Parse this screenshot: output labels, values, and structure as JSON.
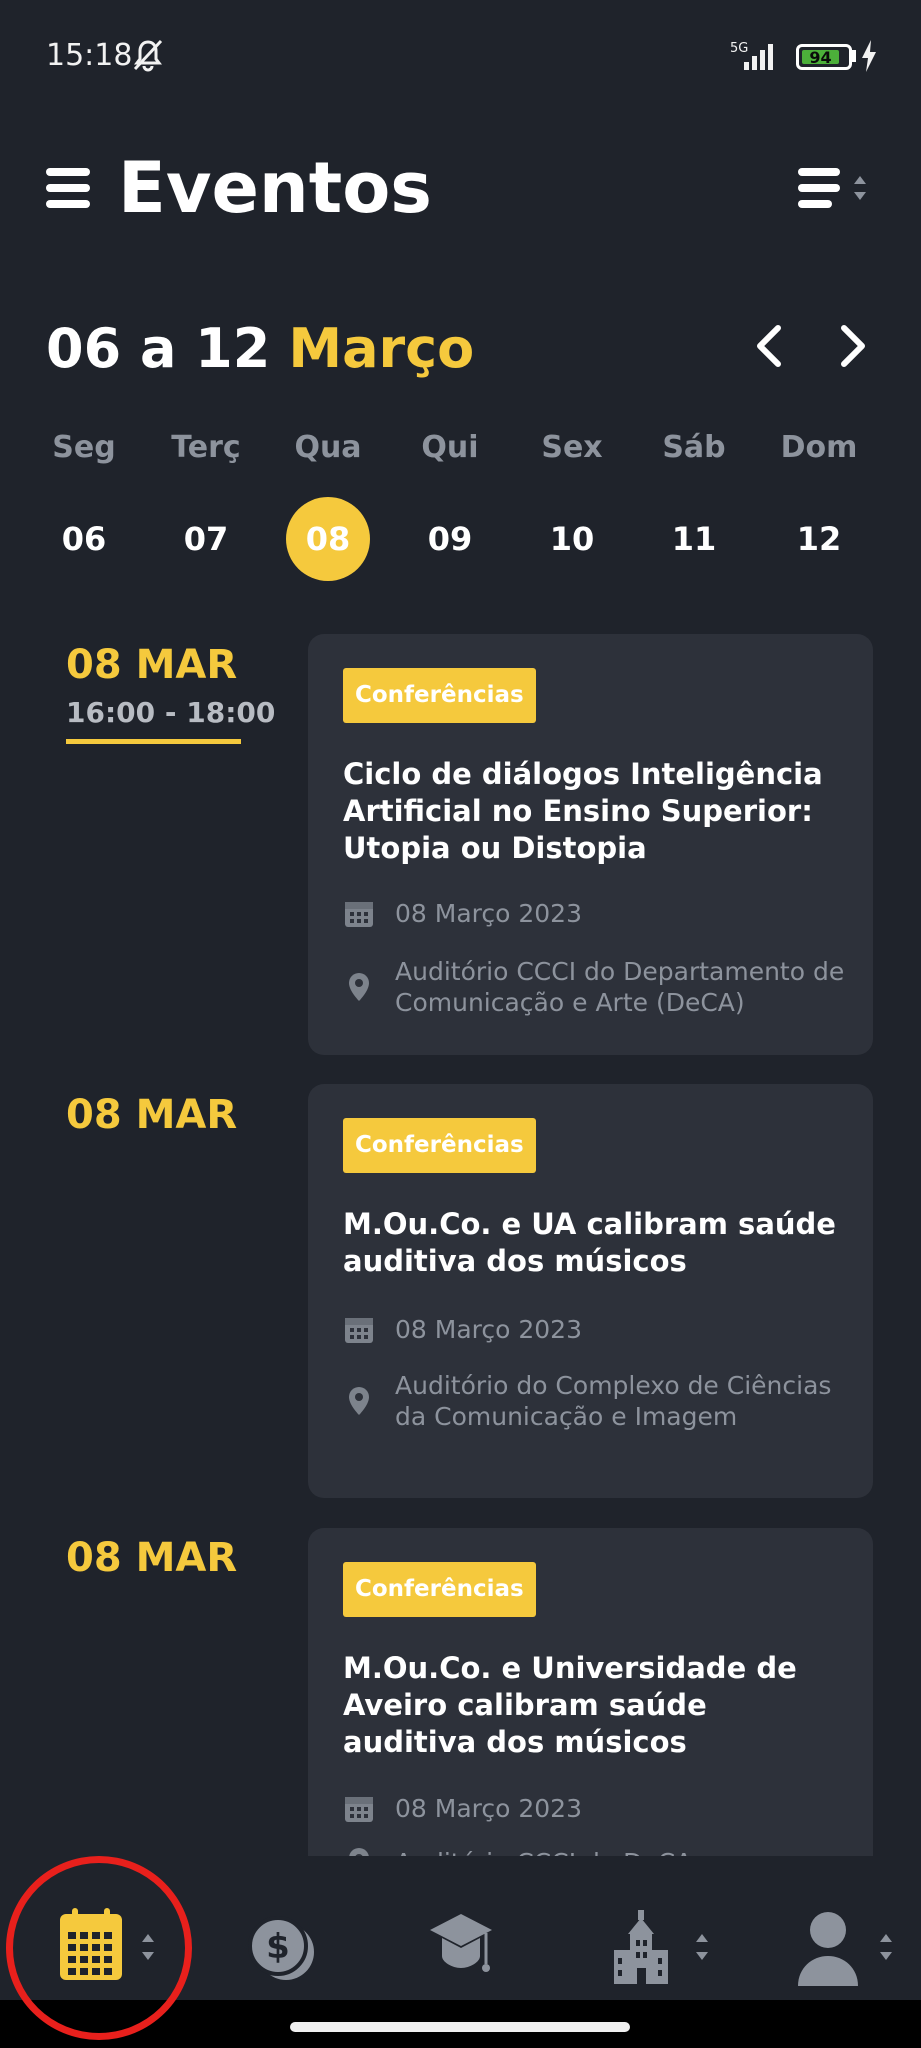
{
  "status_bar": {
    "time": "15:18",
    "network": "5G",
    "battery": "94"
  },
  "header": {
    "title": "Eventos"
  },
  "week": {
    "range": "06 a 12",
    "month": "Março"
  },
  "days": [
    {
      "name": "Seg",
      "num": "06"
    },
    {
      "name": "Terç",
      "num": "07"
    },
    {
      "name": "Qua",
      "num": "08"
    },
    {
      "name": "Qui",
      "num": "09"
    },
    {
      "name": "Sex",
      "num": "10"
    },
    {
      "name": "Sáb",
      "num": "11"
    },
    {
      "name": "Dom",
      "num": "12"
    }
  ],
  "selected_day": "08",
  "events": [
    {
      "date_label": "08 MAR",
      "time": "16:00 - 18:00",
      "tag": "Conferências",
      "title": "Ciclo de diálogos Inteligência Artificial no Ensino Superior: Utopia ou Distopia",
      "date": "08 Março 2023",
      "location": "Auditório CCCI do Departamento de Comunicação e Arte (DeCA)"
    },
    {
      "date_label": "08 MAR",
      "tag": "Conferências",
      "title": "M.Ou.Co. e UA calibram saúde auditiva dos músicos",
      "date": "08 Março 2023",
      "location": "Auditório do Complexo de Ciências da Comunicação e Imagem"
    },
    {
      "date_label": "08 MAR",
      "tag": "Conferências",
      "title": "M.Ou.Co. e Universidade de Aveiro calibram saúde auditiva dos músicos",
      "date": "08 Março 2023",
      "location": "Auditório CCCI do DeCA"
    }
  ],
  "colors": {
    "accent": "#f5c93d",
    "background": "#1f232b",
    "card": "#2d313a",
    "muted": "#8d939d",
    "annotation": "#e8201c"
  },
  "bottom_nav": [
    {
      "icon": "calendar-icon",
      "active": true
    },
    {
      "icon": "money-icon",
      "active": false
    },
    {
      "icon": "graduation-cap-icon",
      "active": false
    },
    {
      "icon": "building-icon",
      "active": false
    },
    {
      "icon": "user-icon",
      "active": false
    }
  ]
}
